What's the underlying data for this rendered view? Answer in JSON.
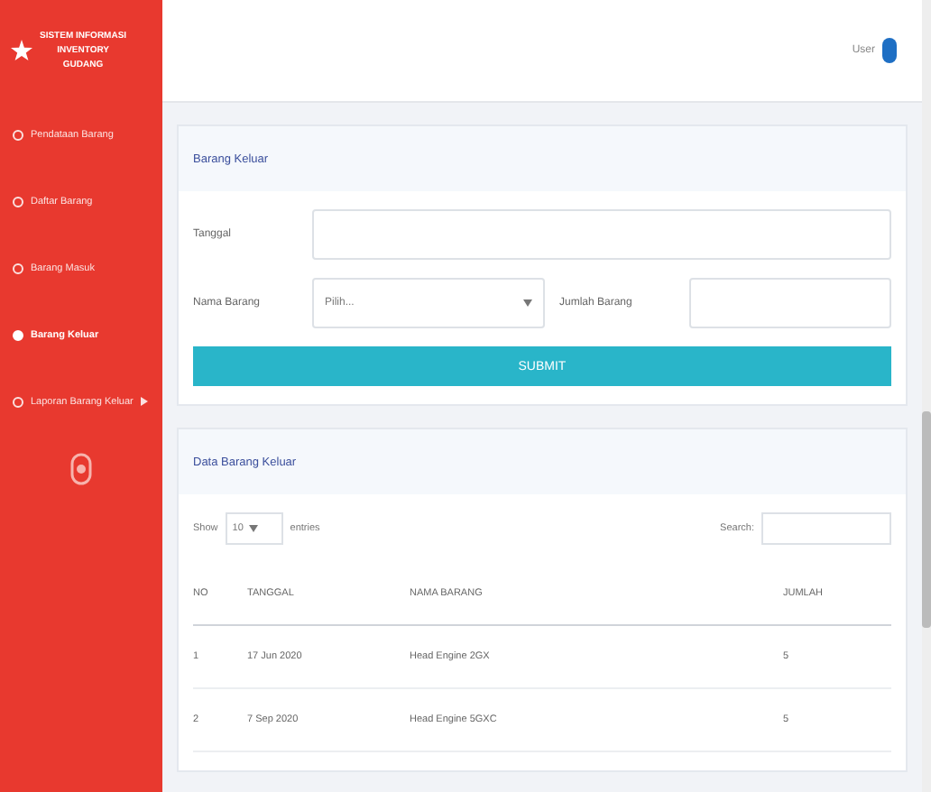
{
  "brand": {
    "lines": [
      "SISTEM INFORMASI",
      "INVENTORY",
      "GUDANG"
    ]
  },
  "sidebar": {
    "items": [
      {
        "label": "Pendataan Barang",
        "selected": false,
        "has_caret": false
      },
      {
        "label": "Daftar Barang",
        "selected": false,
        "has_caret": false
      },
      {
        "label": "Barang Masuk",
        "selected": false,
        "has_caret": false
      },
      {
        "label": "Barang Keluar",
        "selected": true,
        "has_caret": false
      },
      {
        "label": "Laporan Barang Keluar",
        "selected": false,
        "has_caret": true
      }
    ]
  },
  "topbar": {
    "user": "User"
  },
  "form": {
    "title": "Barang Keluar",
    "date_label": "Tanggal",
    "item_label": "Nama Barang",
    "item_placeholder": "Pilih...",
    "qty_label": "Jumlah Barang",
    "submit": "SUBMIT"
  },
  "table": {
    "title": "Data Barang Keluar",
    "show_label": "Show",
    "page_size": "10",
    "entries_label": "entries",
    "search_label": "Search:",
    "columns": [
      "NO",
      "TANGGAL",
      "NAMA BARANG",
      "JUMLAH"
    ],
    "rows": [
      [
        "1",
        "17 Jun 2020",
        "Head Engine 2GX",
        "5"
      ],
      [
        "2",
        "7 Sep 2020",
        "Head Engine 5GXC",
        "5"
      ]
    ]
  }
}
